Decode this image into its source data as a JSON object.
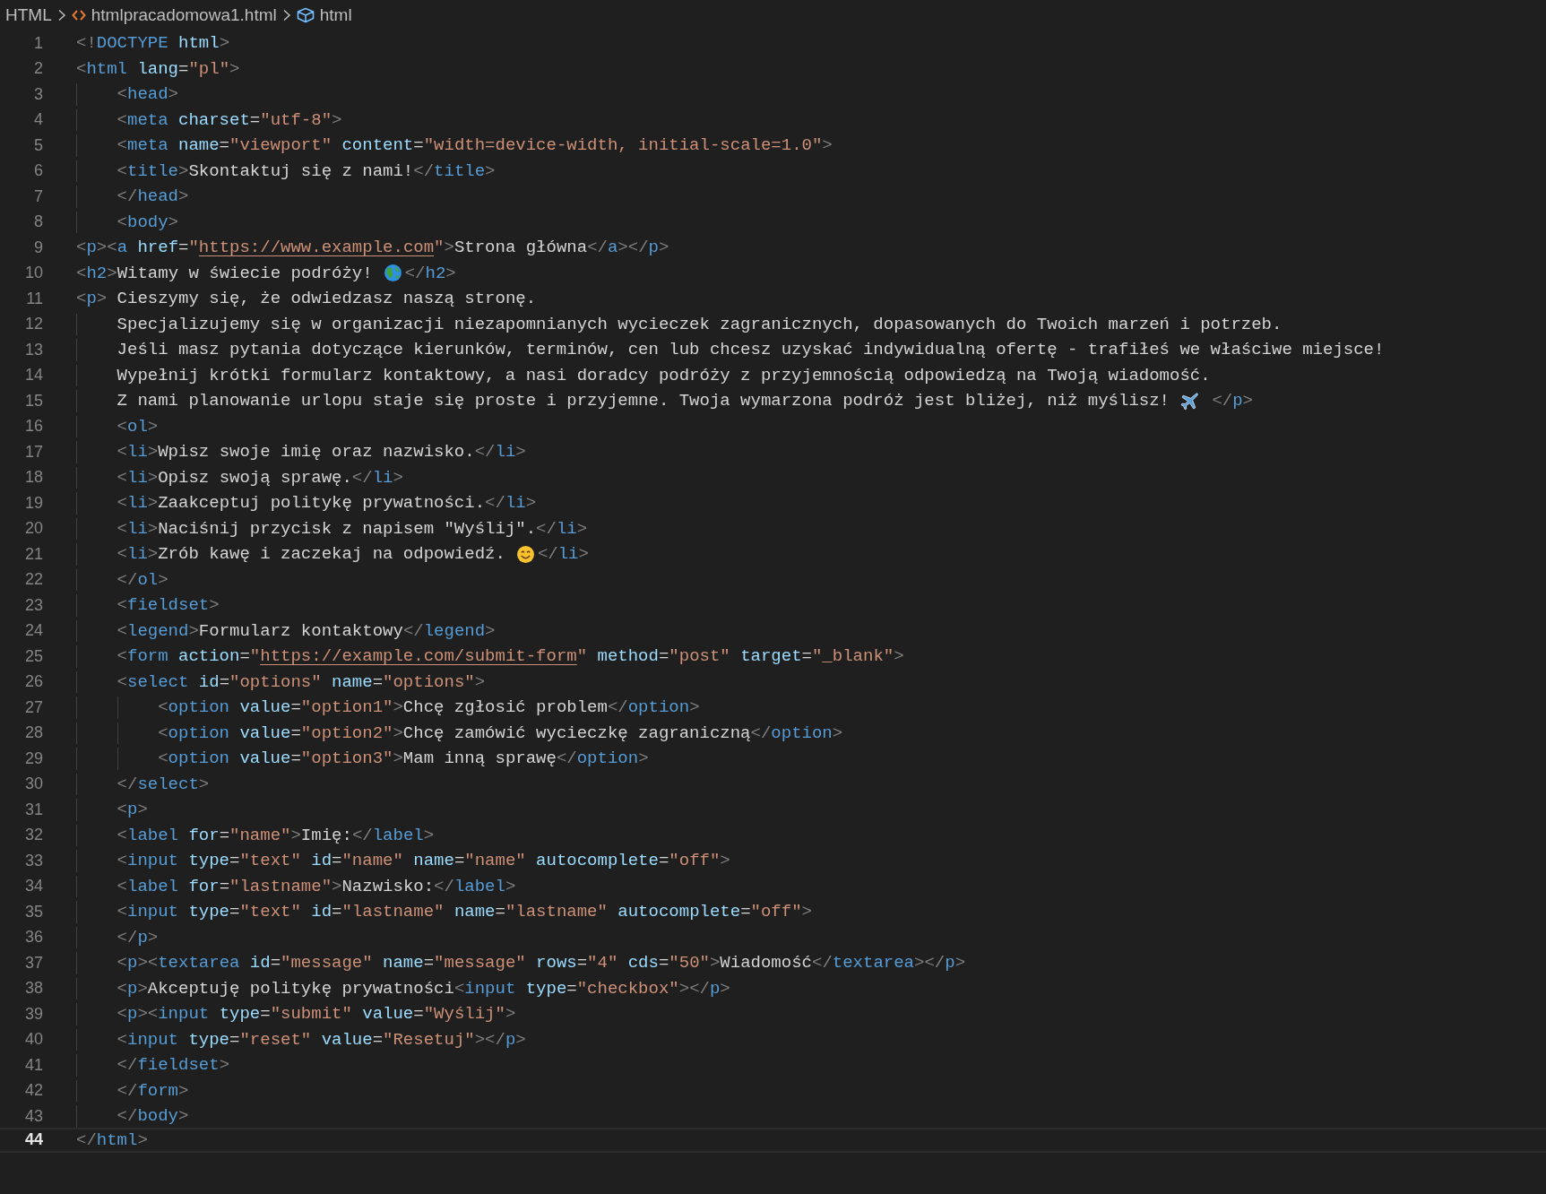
{
  "breadcrumb": [
    {
      "kind": "language",
      "text": "HTML"
    },
    {
      "kind": "file",
      "text": "htmlpracadomowa1.html"
    },
    {
      "kind": "element",
      "text": "html"
    }
  ],
  "lines": [
    {
      "number": "1",
      "selected": false,
      "tokens": [
        {
          "kind": "bracket",
          "text": "<!"
        },
        {
          "kind": "tag",
          "text": "DOCTYPE"
        },
        {
          "kind": "attribute",
          "text": " html"
        },
        {
          "kind": "bracket",
          "text": ">"
        }
      ]
    },
    {
      "number": "2",
      "selected": false,
      "tokens": [
        {
          "kind": "bracket",
          "text": "<"
        },
        {
          "kind": "tag",
          "text": "html"
        },
        {
          "kind": "attribute",
          "text": " lang"
        },
        {
          "kind": "equals",
          "text": "="
        },
        {
          "kind": "string",
          "text": "\"pl\""
        },
        {
          "kind": "bracket",
          "text": ">"
        }
      ]
    },
    {
      "number": "3",
      "selected": false,
      "tokens": [
        {
          "kind": "bracket",
          "text": "    <"
        },
        {
          "kind": "tag",
          "text": "head"
        },
        {
          "kind": "bracket",
          "text": ">"
        }
      ]
    },
    {
      "number": "4",
      "selected": false,
      "tokens": [
        {
          "kind": "bracket",
          "text": "    <"
        },
        {
          "kind": "tag",
          "text": "meta"
        },
        {
          "kind": "attribute",
          "text": " charset"
        },
        {
          "kind": "equals",
          "text": "="
        },
        {
          "kind": "string",
          "text": "\"utf-8\""
        },
        {
          "kind": "bracket",
          "text": ">"
        }
      ]
    },
    {
      "number": "5",
      "selected": false,
      "tokens": [
        {
          "kind": "bracket",
          "text": "    <"
        },
        {
          "kind": "tag",
          "text": "meta"
        },
        {
          "kind": "attribute",
          "text": " name"
        },
        {
          "kind": "equals",
          "text": "="
        },
        {
          "kind": "string",
          "text": "\"viewport\""
        },
        {
          "kind": "attribute",
          "text": " content"
        },
        {
          "kind": "equals",
          "text": "="
        },
        {
          "kind": "string",
          "text": "\"width=device-width, initial-scale=1.0\""
        },
        {
          "kind": "bracket",
          "text": ">"
        }
      ]
    },
    {
      "number": "6",
      "selected": false,
      "tokens": [
        {
          "kind": "bracket",
          "text": "    <"
        },
        {
          "kind": "tag",
          "text": "title"
        },
        {
          "kind": "bracket",
          "text": ">"
        },
        {
          "kind": "text",
          "text": "Skontaktuj się z nami!"
        },
        {
          "kind": "bracket",
          "text": "</"
        },
        {
          "kind": "tag",
          "text": "title"
        },
        {
          "kind": "bracket",
          "text": ">"
        }
      ]
    },
    {
      "number": "7",
      "selected": false,
      "tokens": [
        {
          "kind": "bracket",
          "text": "    </"
        },
        {
          "kind": "tag",
          "text": "head"
        },
        {
          "kind": "bracket",
          "text": ">"
        }
      ]
    },
    {
      "number": "8",
      "selected": false,
      "tokens": [
        {
          "kind": "bracket",
          "text": "    <"
        },
        {
          "kind": "tag",
          "text": "body"
        },
        {
          "kind": "bracket",
          "text": ">"
        }
      ]
    },
    {
      "number": "9",
      "selected": false,
      "tokens": [
        {
          "kind": "bracket",
          "text": "<"
        },
        {
          "kind": "tag",
          "text": "p"
        },
        {
          "kind": "bracket",
          "text": "><"
        },
        {
          "kind": "tag",
          "text": "a"
        },
        {
          "kind": "attribute",
          "text": " href"
        },
        {
          "kind": "equals",
          "text": "="
        },
        {
          "kind": "string",
          "text": "\""
        },
        {
          "kind": "link",
          "text": "https://www.example.com"
        },
        {
          "kind": "string",
          "text": "\""
        },
        {
          "kind": "bracket",
          "text": ">"
        },
        {
          "kind": "text",
          "text": "Strona główna"
        },
        {
          "kind": "bracket",
          "text": "</"
        },
        {
          "kind": "tag",
          "text": "a"
        },
        {
          "kind": "bracket",
          "text": "></"
        },
        {
          "kind": "tag",
          "text": "p"
        },
        {
          "kind": "bracket",
          "text": ">"
        }
      ]
    },
    {
      "number": "10",
      "selected": false,
      "tokens": [
        {
          "kind": "bracket",
          "text": "<"
        },
        {
          "kind": "tag",
          "text": "h2"
        },
        {
          "kind": "bracket",
          "text": ">"
        },
        {
          "kind": "text",
          "text": "Witamy w świecie podróży!"
        },
        {
          "kind": "globe"
        },
        {
          "kind": "bracket",
          "text": "</"
        },
        {
          "kind": "tag",
          "text": "h2"
        },
        {
          "kind": "bracket",
          "text": ">"
        }
      ]
    },
    {
      "number": "11",
      "selected": false,
      "tokens": [
        {
          "kind": "bracket",
          "text": "<"
        },
        {
          "kind": "tag",
          "text": "p"
        },
        {
          "kind": "bracket",
          "text": ">"
        },
        {
          "kind": "text",
          "text": " Cieszymy się, że odwiedzasz naszą stronę."
        }
      ]
    },
    {
      "number": "12",
      "selected": false,
      "tokens": [
        {
          "kind": "text",
          "text": "    Specjalizujemy się w organizacji niezapomnianych wycieczek zagranicznych, dopasowanych do Twoich marzeń i potrzeb."
        }
      ]
    },
    {
      "number": "13",
      "selected": false,
      "tokens": [
        {
          "kind": "text",
          "text": "    Jeśli masz pytania dotyczące kierunków, terminów, cen lub chcesz uzyskać indywidualną ofertę - trafiłeś we właściwe miejsce!"
        }
      ]
    },
    {
      "number": "14",
      "selected": false,
      "tokens": [
        {
          "kind": "text",
          "text": "    Wypełnij krótki formularz kontaktowy, a nasi doradcy podróży z przyjemnością odpowiedzą na Twoją wiadomość."
        }
      ]
    },
    {
      "number": "15",
      "selected": false,
      "tokens": [
        {
          "kind": "text",
          "text": "    Z nami planowanie urlopu staje się proste i przyjemne. Twoja wymarzona podróż jest bliżej, niż myślisz!"
        },
        {
          "kind": "plane"
        },
        {
          "kind": "bracket",
          "text": " </"
        },
        {
          "kind": "tag",
          "text": "p"
        },
        {
          "kind": "bracket",
          "text": ">"
        }
      ]
    },
    {
      "number": "16",
      "selected": false,
      "tokens": [
        {
          "kind": "bracket",
          "text": "    <"
        },
        {
          "kind": "tag",
          "text": "ol"
        },
        {
          "kind": "bracket",
          "text": ">"
        }
      ]
    },
    {
      "number": "17",
      "selected": false,
      "tokens": [
        {
          "kind": "bracket",
          "text": "    <"
        },
        {
          "kind": "tag",
          "text": "li"
        },
        {
          "kind": "bracket",
          "text": ">"
        },
        {
          "kind": "text",
          "text": "Wpisz swoje imię oraz nazwisko."
        },
        {
          "kind": "bracket",
          "text": "</"
        },
        {
          "kind": "tag",
          "text": "li"
        },
        {
          "kind": "bracket",
          "text": ">"
        }
      ]
    },
    {
      "number": "18",
      "selected": false,
      "tokens": [
        {
          "kind": "bracket",
          "text": "    <"
        },
        {
          "kind": "tag",
          "text": "li"
        },
        {
          "kind": "bracket",
          "text": ">"
        },
        {
          "kind": "text",
          "text": "Opisz swoją sprawę."
        },
        {
          "kind": "bracket",
          "text": "</"
        },
        {
          "kind": "tag",
          "text": "li"
        },
        {
          "kind": "bracket",
          "text": ">"
        }
      ]
    },
    {
      "number": "19",
      "selected": false,
      "tokens": [
        {
          "kind": "bracket",
          "text": "    <"
        },
        {
          "kind": "tag",
          "text": "li"
        },
        {
          "kind": "bracket",
          "text": ">"
        },
        {
          "kind": "text",
          "text": "Zaakceptuj politykę prywatności."
        },
        {
          "kind": "bracket",
          "text": "</"
        },
        {
          "kind": "tag",
          "text": "li"
        },
        {
          "kind": "bracket",
          "text": ">"
        }
      ]
    },
    {
      "number": "20",
      "selected": false,
      "tokens": [
        {
          "kind": "bracket",
          "text": "    <"
        },
        {
          "kind": "tag",
          "text": "li"
        },
        {
          "kind": "bracket",
          "text": ">"
        },
        {
          "kind": "text",
          "text": "Naciśnij przycisk z napisem \"Wyślij\"."
        },
        {
          "kind": "bracket",
          "text": "</"
        },
        {
          "kind": "tag",
          "text": "li"
        },
        {
          "kind": "bracket",
          "text": ">"
        }
      ]
    },
    {
      "number": "21",
      "selected": false,
      "tokens": [
        {
          "kind": "bracket",
          "text": "    <"
        },
        {
          "kind": "tag",
          "text": "li"
        },
        {
          "kind": "bracket",
          "text": ">"
        },
        {
          "kind": "text",
          "text": "Zrób kawę i zaczekaj na odpowiedź."
        },
        {
          "kind": "smiley"
        },
        {
          "kind": "bracket",
          "text": "</"
        },
        {
          "kind": "tag",
          "text": "li"
        },
        {
          "kind": "bracket",
          "text": ">"
        }
      ]
    },
    {
      "number": "22",
      "selected": false,
      "tokens": [
        {
          "kind": "bracket",
          "text": "    </"
        },
        {
          "kind": "tag",
          "text": "ol"
        },
        {
          "kind": "bracket",
          "text": ">"
        }
      ]
    },
    {
      "number": "23",
      "selected": false,
      "tokens": [
        {
          "kind": "bracket",
          "text": "    <"
        },
        {
          "kind": "tag",
          "text": "fieldset"
        },
        {
          "kind": "bracket",
          "text": ">"
        }
      ]
    },
    {
      "number": "24",
      "selected": false,
      "tokens": [
        {
          "kind": "bracket",
          "text": "    <"
        },
        {
          "kind": "tag",
          "text": "legend"
        },
        {
          "kind": "bracket",
          "text": ">"
        },
        {
          "kind": "text",
          "text": "Formularz kontaktowy"
        },
        {
          "kind": "bracket",
          "text": "</"
        },
        {
          "kind": "tag",
          "text": "legend"
        },
        {
          "kind": "bracket",
          "text": ">"
        }
      ]
    },
    {
      "number": "25",
      "selected": false,
      "tokens": [
        {
          "kind": "bracket",
          "text": "    <"
        },
        {
          "kind": "tag",
          "text": "form"
        },
        {
          "kind": "attribute",
          "text": " action"
        },
        {
          "kind": "equals",
          "text": "="
        },
        {
          "kind": "string",
          "text": "\""
        },
        {
          "kind": "link",
          "text": "https://example.com/submit-form"
        },
        {
          "kind": "string",
          "text": "\""
        },
        {
          "kind": "attribute",
          "text": " method"
        },
        {
          "kind": "equals",
          "text": "="
        },
        {
          "kind": "string",
          "text": "\"post\""
        },
        {
          "kind": "attribute",
          "text": " target"
        },
        {
          "kind": "equals",
          "text": "="
        },
        {
          "kind": "string",
          "text": "\"_blank\""
        },
        {
          "kind": "bracket",
          "text": ">"
        }
      ]
    },
    {
      "number": "26",
      "selected": false,
      "tokens": [
        {
          "kind": "bracket",
          "text": "    <"
        },
        {
          "kind": "tag",
          "text": "select"
        },
        {
          "kind": "attribute",
          "text": " id"
        },
        {
          "kind": "equals",
          "text": "="
        },
        {
          "kind": "string",
          "text": "\"options\""
        },
        {
          "kind": "attribute",
          "text": " name"
        },
        {
          "kind": "equals",
          "text": "="
        },
        {
          "kind": "string",
          "text": "\"options\""
        },
        {
          "kind": "bracket",
          "text": ">"
        }
      ]
    },
    {
      "number": "27",
      "selected": false,
      "tokens": [
        {
          "kind": "bracket",
          "text": "        <"
        },
        {
          "kind": "tag",
          "text": "option"
        },
        {
          "kind": "attribute",
          "text": " value"
        },
        {
          "kind": "equals",
          "text": "="
        },
        {
          "kind": "string",
          "text": "\"option1\""
        },
        {
          "kind": "bracket",
          "text": ">"
        },
        {
          "kind": "text",
          "text": "Chcę zgłosić problem"
        },
        {
          "kind": "bracket",
          "text": "</"
        },
        {
          "kind": "tag",
          "text": "option"
        },
        {
          "kind": "bracket",
          "text": ">"
        }
      ]
    },
    {
      "number": "28",
      "selected": false,
      "tokens": [
        {
          "kind": "bracket",
          "text": "        <"
        },
        {
          "kind": "tag",
          "text": "option"
        },
        {
          "kind": "attribute",
          "text": " value"
        },
        {
          "kind": "equals",
          "text": "="
        },
        {
          "kind": "string",
          "text": "\"option2\""
        },
        {
          "kind": "bracket",
          "text": ">"
        },
        {
          "kind": "text",
          "text": "Chcę zamówić wycieczkę zagraniczną"
        },
        {
          "kind": "bracket",
          "text": "</"
        },
        {
          "kind": "tag",
          "text": "option"
        },
        {
          "kind": "bracket",
          "text": ">"
        }
      ]
    },
    {
      "number": "29",
      "selected": false,
      "tokens": [
        {
          "kind": "bracket",
          "text": "        <"
        },
        {
          "kind": "tag",
          "text": "option"
        },
        {
          "kind": "attribute",
          "text": " value"
        },
        {
          "kind": "equals",
          "text": "="
        },
        {
          "kind": "string",
          "text": "\"option3\""
        },
        {
          "kind": "bracket",
          "text": ">"
        },
        {
          "kind": "text",
          "text": "Mam inną sprawę"
        },
        {
          "kind": "bracket",
          "text": "</"
        },
        {
          "kind": "tag",
          "text": "option"
        },
        {
          "kind": "bracket",
          "text": ">"
        }
      ]
    },
    {
      "number": "30",
      "selected": false,
      "tokens": [
        {
          "kind": "bracket",
          "text": "    </"
        },
        {
          "kind": "tag",
          "text": "select"
        },
        {
          "kind": "bracket",
          "text": ">"
        }
      ]
    },
    {
      "number": "31",
      "selected": false,
      "tokens": [
        {
          "kind": "bracket",
          "text": "    <"
        },
        {
          "kind": "tag",
          "text": "p"
        },
        {
          "kind": "bracket",
          "text": ">"
        }
      ]
    },
    {
      "number": "32",
      "selected": false,
      "tokens": [
        {
          "kind": "bracket",
          "text": "    <"
        },
        {
          "kind": "tag",
          "text": "label"
        },
        {
          "kind": "attribute",
          "text": " for"
        },
        {
          "kind": "equals",
          "text": "="
        },
        {
          "kind": "string",
          "text": "\"name\""
        },
        {
          "kind": "bracket",
          "text": ">"
        },
        {
          "kind": "text",
          "text": "Imię:"
        },
        {
          "kind": "bracket",
          "text": "</"
        },
        {
          "kind": "tag",
          "text": "label"
        },
        {
          "kind": "bracket",
          "text": ">"
        }
      ]
    },
    {
      "number": "33",
      "selected": false,
      "tokens": [
        {
          "kind": "bracket",
          "text": "    <"
        },
        {
          "kind": "tag",
          "text": "input"
        },
        {
          "kind": "attribute",
          "text": " type"
        },
        {
          "kind": "equals",
          "text": "="
        },
        {
          "kind": "string",
          "text": "\"text\""
        },
        {
          "kind": "attribute",
          "text": " id"
        },
        {
          "kind": "equals",
          "text": "="
        },
        {
          "kind": "string",
          "text": "\"name\""
        },
        {
          "kind": "attribute",
          "text": " name"
        },
        {
          "kind": "equals",
          "text": "="
        },
        {
          "kind": "string",
          "text": "\"name\""
        },
        {
          "kind": "attribute",
          "text": " autocomplete"
        },
        {
          "kind": "equals",
          "text": "="
        },
        {
          "kind": "string",
          "text": "\"off\""
        },
        {
          "kind": "bracket",
          "text": ">"
        }
      ]
    },
    {
      "number": "34",
      "selected": false,
      "tokens": [
        {
          "kind": "bracket",
          "text": "    <"
        },
        {
          "kind": "tag",
          "text": "label"
        },
        {
          "kind": "attribute",
          "text": " for"
        },
        {
          "kind": "equals",
          "text": "="
        },
        {
          "kind": "string",
          "text": "\"lastname\""
        },
        {
          "kind": "bracket",
          "text": ">"
        },
        {
          "kind": "text",
          "text": "Nazwisko:"
        },
        {
          "kind": "bracket",
          "text": "</"
        },
        {
          "kind": "tag",
          "text": "label"
        },
        {
          "kind": "bracket",
          "text": ">"
        }
      ]
    },
    {
      "number": "35",
      "selected": false,
      "tokens": [
        {
          "kind": "bracket",
          "text": "    <"
        },
        {
          "kind": "tag",
          "text": "input"
        },
        {
          "kind": "attribute",
          "text": " type"
        },
        {
          "kind": "equals",
          "text": "="
        },
        {
          "kind": "string",
          "text": "\"text\""
        },
        {
          "kind": "attribute",
          "text": " id"
        },
        {
          "kind": "equals",
          "text": "="
        },
        {
          "kind": "string",
          "text": "\"lastname\""
        },
        {
          "kind": "attribute",
          "text": " name"
        },
        {
          "kind": "equals",
          "text": "="
        },
        {
          "kind": "string",
          "text": "\"lastname\""
        },
        {
          "kind": "attribute",
          "text": " autocomplete"
        },
        {
          "kind": "equals",
          "text": "="
        },
        {
          "kind": "string",
          "text": "\"off\""
        },
        {
          "kind": "bracket",
          "text": ">"
        }
      ]
    },
    {
      "number": "36",
      "selected": false,
      "tokens": [
        {
          "kind": "bracket",
          "text": "    </"
        },
        {
          "kind": "tag",
          "text": "p"
        },
        {
          "kind": "bracket",
          "text": ">"
        }
      ]
    },
    {
      "number": "37",
      "selected": false,
      "tokens": [
        {
          "kind": "bracket",
          "text": "    <"
        },
        {
          "kind": "tag",
          "text": "p"
        },
        {
          "kind": "bracket",
          "text": "><"
        },
        {
          "kind": "tag",
          "text": "textarea"
        },
        {
          "kind": "attribute",
          "text": " id"
        },
        {
          "kind": "equals",
          "text": "="
        },
        {
          "kind": "string",
          "text": "\"message\""
        },
        {
          "kind": "attribute",
          "text": " name"
        },
        {
          "kind": "equals",
          "text": "="
        },
        {
          "kind": "string",
          "text": "\"message\""
        },
        {
          "kind": "attribute",
          "text": " rows"
        },
        {
          "kind": "equals",
          "text": "="
        },
        {
          "kind": "string",
          "text": "\"4\""
        },
        {
          "kind": "attribute",
          "text": " cds"
        },
        {
          "kind": "equals",
          "text": "="
        },
        {
          "kind": "string",
          "text": "\"50\""
        },
        {
          "kind": "bracket",
          "text": ">"
        },
        {
          "kind": "text",
          "text": "Wiadomość"
        },
        {
          "kind": "bracket",
          "text": "</"
        },
        {
          "kind": "tag",
          "text": "textarea"
        },
        {
          "kind": "bracket",
          "text": "></"
        },
        {
          "kind": "tag",
          "text": "p"
        },
        {
          "kind": "bracket",
          "text": ">"
        }
      ]
    },
    {
      "number": "38",
      "selected": false,
      "tokens": [
        {
          "kind": "bracket",
          "text": "    <"
        },
        {
          "kind": "tag",
          "text": "p"
        },
        {
          "kind": "bracket",
          "text": ">"
        },
        {
          "kind": "text",
          "text": "Akceptuję politykę prywatności"
        },
        {
          "kind": "bracket",
          "text": "<"
        },
        {
          "kind": "tag",
          "text": "input"
        },
        {
          "kind": "attribute",
          "text": " type"
        },
        {
          "kind": "equals",
          "text": "="
        },
        {
          "kind": "string",
          "text": "\"checkbox\""
        },
        {
          "kind": "bracket",
          "text": "></"
        },
        {
          "kind": "tag",
          "text": "p"
        },
        {
          "kind": "bracket",
          "text": ">"
        }
      ]
    },
    {
      "number": "39",
      "selected": false,
      "tokens": [
        {
          "kind": "bracket",
          "text": "    <"
        },
        {
          "kind": "tag",
          "text": "p"
        },
        {
          "kind": "bracket",
          "text": "><"
        },
        {
          "kind": "tag",
          "text": "input"
        },
        {
          "kind": "attribute",
          "text": " type"
        },
        {
          "kind": "equals",
          "text": "="
        },
        {
          "kind": "string",
          "text": "\"submit\""
        },
        {
          "kind": "attribute",
          "text": " value"
        },
        {
          "kind": "equals",
          "text": "="
        },
        {
          "kind": "string",
          "text": "\"Wyślij\""
        },
        {
          "kind": "bracket",
          "text": ">"
        }
      ]
    },
    {
      "number": "40",
      "selected": false,
      "tokens": [
        {
          "kind": "bracket",
          "text": "    <"
        },
        {
          "kind": "tag",
          "text": "input"
        },
        {
          "kind": "attribute",
          "text": " type"
        },
        {
          "kind": "equals",
          "text": "="
        },
        {
          "kind": "string",
          "text": "\"reset\""
        },
        {
          "kind": "attribute",
          "text": " value"
        },
        {
          "kind": "equals",
          "text": "="
        },
        {
          "kind": "string",
          "text": "\"Resetuj\""
        },
        {
          "kind": "bracket",
          "text": "></"
        },
        {
          "kind": "tag",
          "text": "p"
        },
        {
          "kind": "bracket",
          "text": ">"
        }
      ]
    },
    {
      "number": "41",
      "selected": false,
      "tokens": [
        {
          "kind": "bracket",
          "text": "    </"
        },
        {
          "kind": "tag",
          "text": "fieldset"
        },
        {
          "kind": "bracket",
          "text": ">"
        }
      ]
    },
    {
      "number": "42",
      "selected": false,
      "tokens": [
        {
          "kind": "bracket",
          "text": "    </"
        },
        {
          "kind": "tag",
          "text": "form"
        },
        {
          "kind": "bracket",
          "text": ">"
        }
      ]
    },
    {
      "number": "43",
      "selected": false,
      "tokens": [
        {
          "kind": "bracket",
          "text": "    </"
        },
        {
          "kind": "tag",
          "text": "body"
        },
        {
          "kind": "bracket",
          "text": ">"
        }
      ]
    },
    {
      "number": "44",
      "selected": true,
      "tokens": [
        {
          "kind": "bracket",
          "text": "</"
        },
        {
          "kind": "tag",
          "text": "html"
        },
        {
          "kind": "bracket",
          "text": ">"
        }
      ]
    }
  ]
}
